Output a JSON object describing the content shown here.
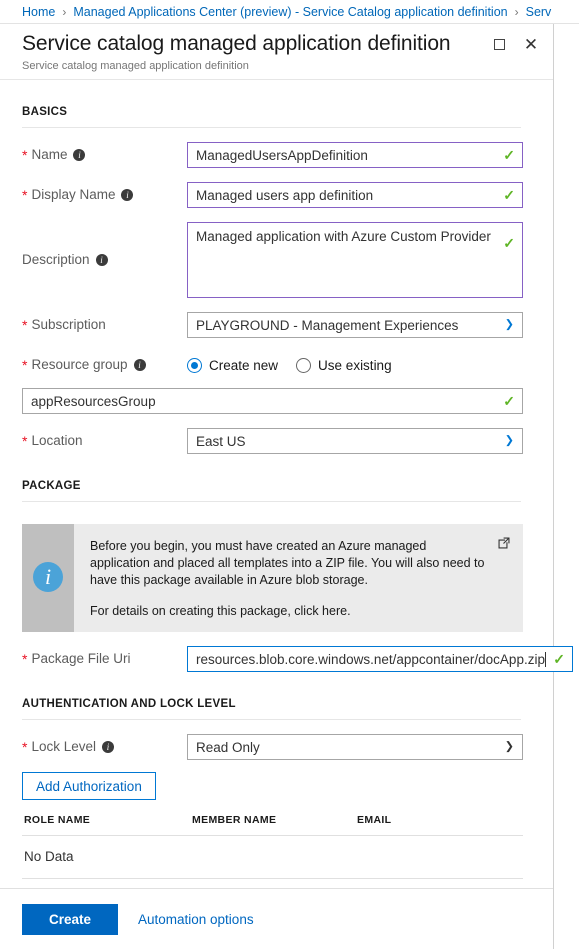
{
  "breadcrumb": {
    "items": [
      "Home",
      "Managed Applications Center (preview) - Service Catalog application definition",
      "Serv"
    ],
    "separator": "›"
  },
  "blade": {
    "title": "Service catalog managed application definition",
    "subtitle": "Service catalog managed application definition",
    "maximize_icon": "maximize-icon",
    "close_icon": "close-icon"
  },
  "sections": {
    "basics": {
      "heading": "BASICS",
      "name": {
        "label": "Name",
        "value": "ManagedUsersAppDefinition",
        "required_marker": "*",
        "info_glyph": "i",
        "valid_glyph": "✓"
      },
      "display_name": {
        "label": "Display Name",
        "value": "Managed users app definition",
        "required_marker": "*",
        "info_glyph": "i",
        "valid_glyph": "✓"
      },
      "description": {
        "label": "Description",
        "value": "Managed application with Azure Custom Provider",
        "info_glyph": "i",
        "valid_glyph": "✓"
      },
      "subscription": {
        "label": "Subscription",
        "value": "PLAYGROUND - Management Experiences",
        "required_marker": "*",
        "caret_glyph": "⌵"
      },
      "resource_group": {
        "label": "Resource group",
        "required_marker": "*",
        "info_glyph": "i",
        "options": [
          {
            "label": "Create new",
            "selected": true
          },
          {
            "label": "Use existing",
            "selected": false
          }
        ],
        "value": "appResourcesGroup",
        "valid_glyph": "✓"
      },
      "location": {
        "label": "Location",
        "value": "East US",
        "required_marker": "*",
        "caret_glyph": "⌵"
      }
    },
    "package": {
      "heading": "PACKAGE",
      "info_banner": {
        "icon": "info-icon",
        "paragraph1": "Before you begin, you must have created an Azure managed application and placed all templates into a ZIP file. You will also need to have this package available in Azure blob storage.",
        "paragraph2": "For details on creating this package, click here.",
        "external_link_icon": "external-link-icon"
      },
      "package_file_uri": {
        "label": "Package File Uri",
        "value": "resources.blob.core.windows.net/appcontainer/docApp.zip",
        "required_marker": "*",
        "valid_glyph": "✓"
      }
    },
    "auth": {
      "heading": "AUTHENTICATION AND LOCK LEVEL",
      "lock_level": {
        "label": "Lock Level",
        "value": "Read Only",
        "required_marker": "*",
        "info_glyph": "i",
        "caret_glyph": "⌵"
      },
      "add_authorization_label": "Add Authorization",
      "table": {
        "columns": [
          "ROLE NAME",
          "MEMBER NAME",
          "EMAIL"
        ],
        "empty_text": "No Data"
      }
    }
  },
  "footer": {
    "create_label": "Create",
    "automation_label": "Automation options"
  }
}
